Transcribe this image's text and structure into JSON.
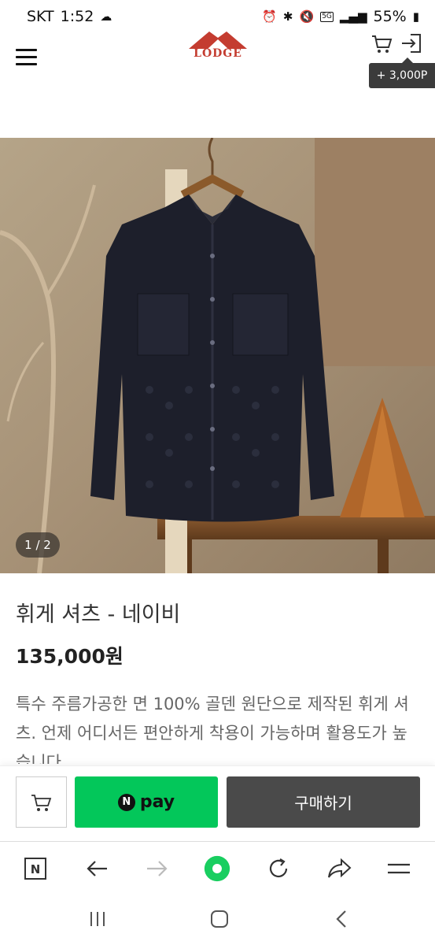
{
  "status_bar": {
    "carrier": "SKT",
    "time": "1:52",
    "network": "5G",
    "battery": "55%"
  },
  "header": {
    "logo_text": "LODGE",
    "points_badge": "+ 3,000P"
  },
  "product": {
    "image_counter": "1 / 2",
    "name": "휘게 셔츠 - 네이비",
    "price": "135,000원",
    "description": "특수 주름가공한 면 100% 골덴 원단으로 제작된 휘게 셔츠. 언제 어디서든 편안하게 착용이 가능하며 활용도가 높습니다."
  },
  "buy_bar": {
    "npay_n": "N",
    "npay_label": "pay",
    "purchase_label": "구매하기"
  },
  "browser_toolbar": {
    "home_letter": "N"
  },
  "colors": {
    "npay_green": "#03c75a",
    "purchase_dark": "#4a4a4a",
    "logo_red": "#c43c30",
    "browser_green": "#19ce60"
  },
  "icons": [
    "menu-icon",
    "cart-icon",
    "login-icon",
    "back-icon",
    "forward-icon",
    "reload-icon",
    "share-icon",
    "recent-apps-icon",
    "home-icon"
  ]
}
